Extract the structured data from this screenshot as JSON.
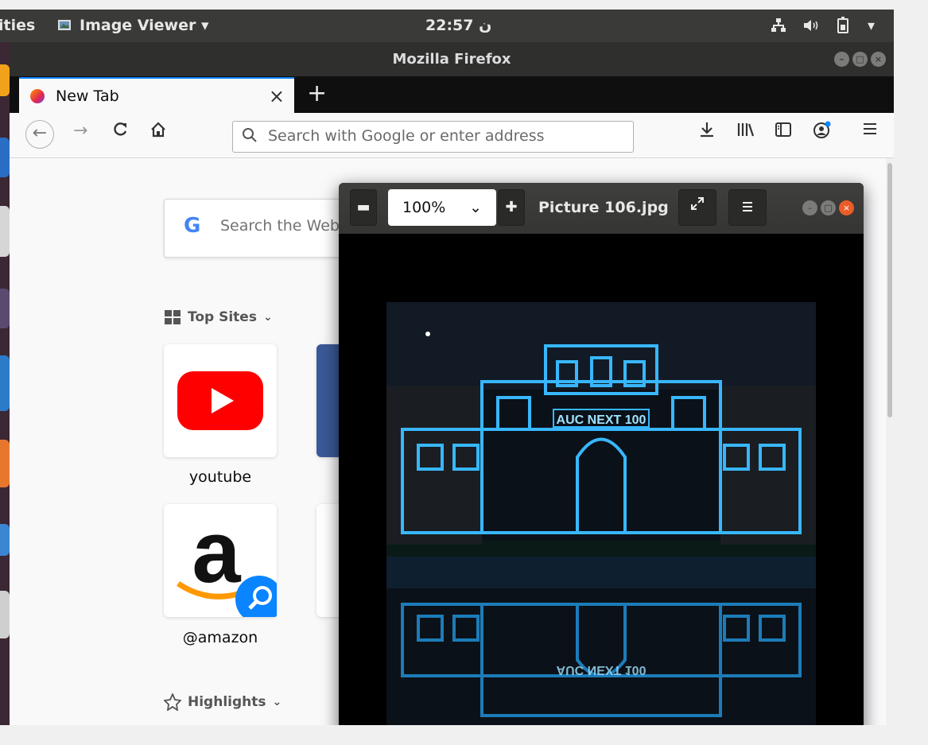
{
  "topbar": {
    "activities": "ities",
    "app_menu": "Image Viewer ▾",
    "clock": "22:57 ن",
    "tray": {
      "network": "network-icon",
      "volume": "volume-icon",
      "battery": "battery-icon",
      "menu": "▾"
    }
  },
  "firefox": {
    "window_title": "Mozilla Firefox",
    "tab_title": "New Tab",
    "tab_close": "×",
    "new_tab": "+",
    "url_placeholder": "Search with Google or enter address",
    "search_box_text": "Search the Web",
    "top_sites_label": "Top Sites",
    "highlights_label": "Highlights",
    "tiles": [
      {
        "label": "youtube"
      },
      {
        "label": "@amazon"
      }
    ]
  },
  "image_viewer": {
    "zoom": "100%",
    "file_title": "Picture 106.jpg",
    "photo_caption": "AUC NEXT 100",
    "photo_caption_reflection": "AUC NEXT 100"
  },
  "colors": {
    "accent": "#0a84ff",
    "close_orange": "#ea5d29",
    "youtube_red": "#ff0000",
    "photo_cyan": "#38b7ff"
  }
}
